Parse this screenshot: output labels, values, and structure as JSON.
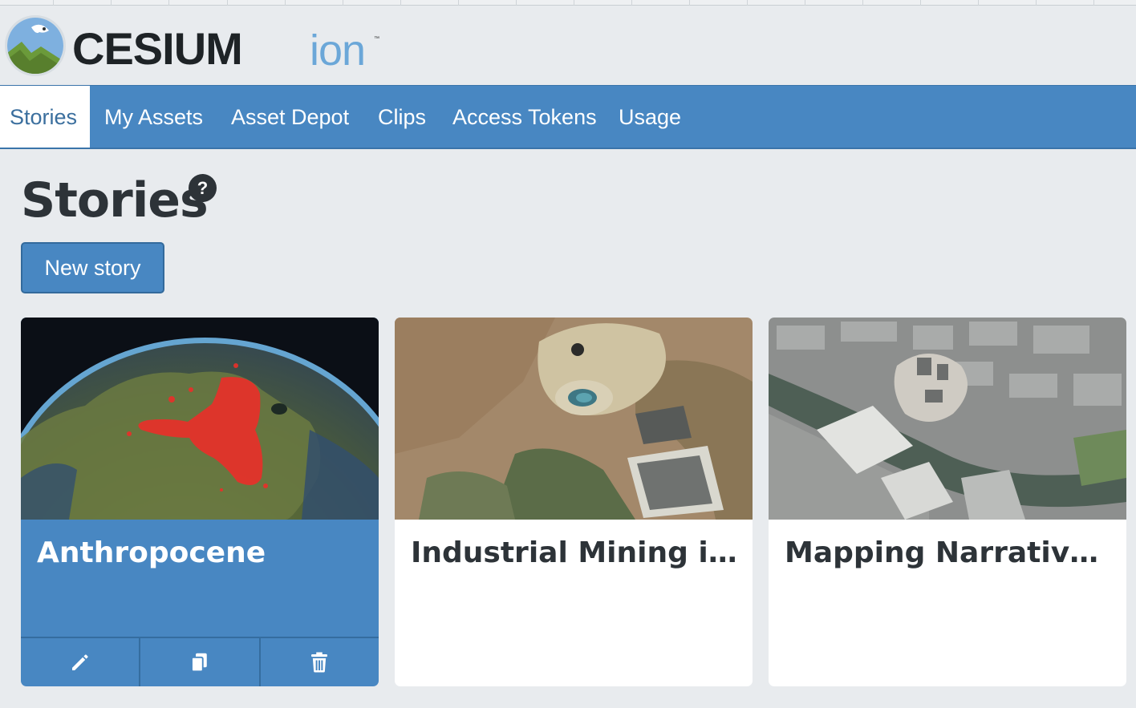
{
  "brand": {
    "name": "CESIUM",
    "product": "ion",
    "tm": "™"
  },
  "nav": {
    "tabs": [
      {
        "label": "Stories",
        "active": true
      },
      {
        "label": "My Assets"
      },
      {
        "label": "Asset Depot"
      },
      {
        "label": "Clips"
      },
      {
        "label": "Access Tokens"
      },
      {
        "label": "Usage"
      }
    ]
  },
  "page": {
    "title": "Stories",
    "help_glyph": "?",
    "new_story_label": "New story"
  },
  "stories": [
    {
      "title": "Anthropocene",
      "selected": true,
      "thumbnail": "earth-globe-africa"
    },
    {
      "title": "Industrial Mining in D...",
      "thumbnail": "aerial-mine"
    },
    {
      "title": "Mapping Narratives: ...",
      "thumbnail": "aerial-city"
    }
  ],
  "card_actions": [
    "pencil-icon",
    "copy-icon",
    "trash-icon"
  ],
  "colors": {
    "brand_blue": "#4887c2",
    "background": "#e8ebee",
    "title_text": "#2d3338",
    "logo_ion": "#6ba7d8"
  }
}
